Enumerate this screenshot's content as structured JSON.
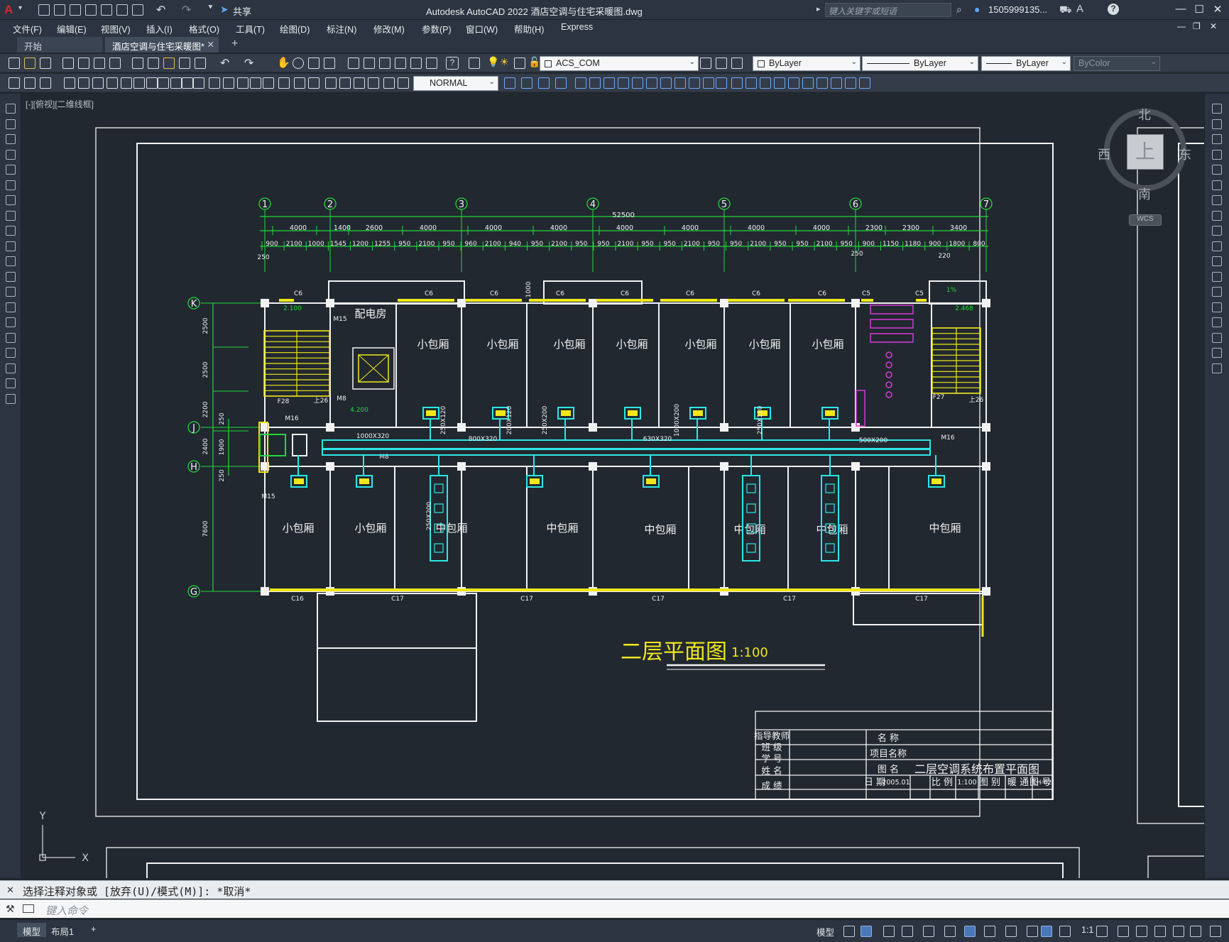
{
  "app": {
    "title": "Autodesk AutoCAD 2022    酒店空调与住宅采暖图.dwg",
    "share_label": "共享",
    "search_placeholder": "键入关键字或短语",
    "user_label": "1505999135...",
    "window_controls": [
      "—",
      "☐",
      "✕"
    ]
  },
  "menubar": {
    "items": [
      "文件(F)",
      "编辑(E)",
      "视图(V)",
      "插入(I)",
      "格式(O)",
      "工具(T)",
      "绘图(D)",
      "标注(N)",
      "修改(M)",
      "参数(P)",
      "窗口(W)",
      "帮助(H)",
      "Express"
    ]
  },
  "tabs": {
    "start": "开始",
    "document": "酒店空调与住宅采暖图*",
    "close": "✕",
    "add": "+"
  },
  "toolbar": {
    "layer_combo": "ACS_COM",
    "color_combo": "ByLayer",
    "linetype_combo": "ByLayer",
    "lineweight_combo": "ByLayer",
    "plotstyle_combo": "ByColor",
    "style_combo": "NORMAL"
  },
  "viewport": {
    "label": "[-][俯视][二维线框]"
  },
  "viewcube": {
    "north": "北",
    "south": "南",
    "east": "东",
    "west": "西",
    "top": "上",
    "wcs": "WCS"
  },
  "drawing": {
    "grid_numbers": [
      "1",
      "2",
      "3",
      "4",
      "5",
      "6",
      "7"
    ],
    "grid_letters": [
      "K",
      "J",
      "H",
      "G"
    ],
    "overall_dimension": "52500",
    "dim_row1": [
      "4000",
      "1400",
      "2600",
      "4000",
      "4000",
      "4000",
      "4000",
      "4000",
      "4000",
      "4000",
      "2300",
      "2300",
      "3400"
    ],
    "dim_row2": [
      "900",
      "2100",
      "1000",
      "1545",
      "1200",
      "1255",
      "950",
      "2100",
      "950",
      "960",
      "2100",
      "940",
      "950",
      "2100",
      "950",
      "950",
      "2100",
      "950",
      "950",
      "2100",
      "950",
      "950",
      "2100",
      "950",
      "950",
      "2100",
      "950",
      "900",
      "1150",
      "1180",
      "900",
      "1800",
      "800"
    ],
    "dim_left": [
      "2500",
      "2500",
      "2200",
      "2400",
      "7600"
    ],
    "dim_left_inner": [
      "250",
      "1900",
      "250"
    ],
    "dim_misc": [
      "250",
      "250",
      "220",
      "1000"
    ],
    "rooms_top": [
      "小包厢",
      "小包厢",
      "小包厢",
      "小包厢",
      "小包厢",
      "小包厢",
      "小包厢"
    ],
    "rooms_bottom": [
      "小包厢",
      "小包厢",
      "中包厢",
      "中包厢",
      "中包厢",
      "中包厢",
      "中包厢",
      "中包厢"
    ],
    "power_room": "配电房",
    "window_tags_top": [
      "C6",
      "C6",
      "C6",
      "C6",
      "C6",
      "C6",
      "C6",
      "C6",
      "C5",
      "C5"
    ],
    "window_tags_bottom": [
      "C16",
      "C17",
      "C17",
      "C17",
      "C17",
      "C17"
    ],
    "door_tags": [
      "M15",
      "M8",
      "M16",
      "M8",
      "M16",
      "M15"
    ],
    "stair_tags": [
      "F28",
      "上26",
      "F27",
      "上26"
    ],
    "elevations": [
      "2.100",
      "4.200",
      "2.468",
      "1%"
    ],
    "duct_sizes": [
      "1000X320",
      "800X320",
      "630X320",
      "500X200",
      "250X120",
      "200X120",
      "250X200",
      "1000X200",
      "250X120",
      "250X200"
    ],
    "title": "二层平面图",
    "scale": "1:100"
  },
  "title_block": {
    "left_labels": [
      "指导教师",
      "班 级",
      "学 号",
      "姓 名",
      "成 绩"
    ],
    "name_label": "名 称",
    "project_label": "项目名称",
    "drawing_name_label": "图 名",
    "drawing_name": "二层空调系统布置平面图",
    "date_label": "日 期",
    "date": "2005.01",
    "scale_label": "比 例",
    "scale": "1:100",
    "category_label": "图 别",
    "category": "暖 通",
    "number_label": "图 号",
    "number": "LH-02"
  },
  "command": {
    "history": "选择注释对象或 [放弃(U)/模式(M)]: *取消*",
    "input_placeholder": "键入命令"
  },
  "statusbar": {
    "model_tab": "模型",
    "layout_tab": "布局1",
    "add_layout": "+",
    "model_label": "模型",
    "scale": "1:1"
  },
  "colors": {
    "background": "#212830",
    "border_white": "#ffffff",
    "axis_green": "#22d83a",
    "wall_white": "#f2f2f2",
    "window_yellow": "#f0e71a",
    "duct_cyan": "#2de6e6",
    "fixture_magenta": "#d43ad4",
    "title_yellow": "#f0e71a"
  }
}
